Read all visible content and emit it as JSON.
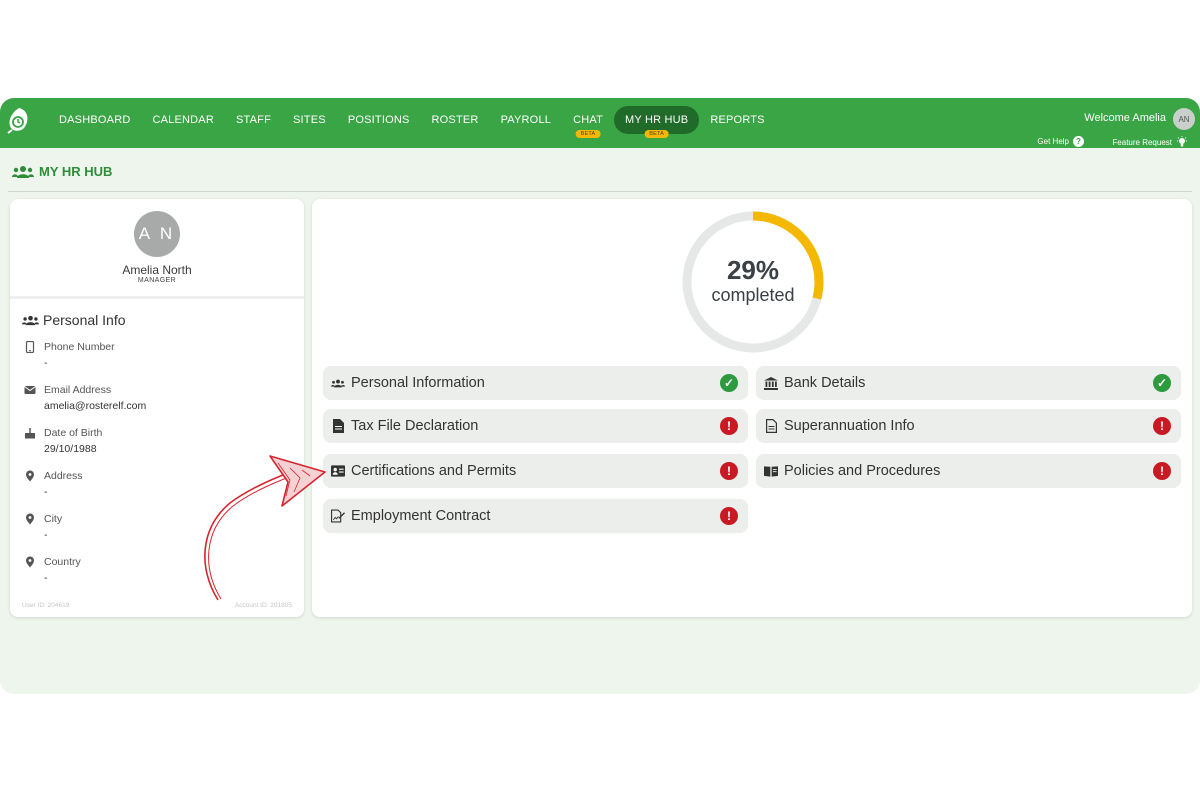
{
  "colors": {
    "brand_green": "#3aa545",
    "active_green": "#216b2a",
    "progress": "#f5b800",
    "ok": "#2e9a3e",
    "warn": "#c81a22",
    "annotation_arrow": "#d6252f"
  },
  "nav": {
    "items": [
      {
        "label": "DASHBOARD"
      },
      {
        "label": "CALENDAR"
      },
      {
        "label": "STAFF"
      },
      {
        "label": "SITES"
      },
      {
        "label": "POSITIONS"
      },
      {
        "label": "ROSTER"
      },
      {
        "label": "PAYROLL"
      },
      {
        "label": "CHAT",
        "badge": "BETA"
      },
      {
        "label": "MY HR HUB",
        "badge": "BETA",
        "active": true
      },
      {
        "label": "REPORTS"
      }
    ],
    "welcome": "Welcome Amelia",
    "avatar_initials": "AN",
    "get_help": "Get Help",
    "feature_request": "Feature Request"
  },
  "page": {
    "title": "MY HR HUB",
    "title_icon": "users-icon"
  },
  "profile": {
    "initials": "A N",
    "name": "Amelia North",
    "role": "MANAGER",
    "section_title": "Personal Info",
    "fields": [
      {
        "icon": "phone-icon",
        "label": "Phone Number",
        "value": "-"
      },
      {
        "icon": "envelope-icon",
        "label": "Email Address",
        "value": "amelia@rosterelf.com"
      },
      {
        "icon": "cake-icon",
        "label": "Date of Birth",
        "value": "29/10/1988"
      },
      {
        "icon": "map-pin-icon",
        "label": "Address",
        "value": "-"
      },
      {
        "icon": "map-pin-icon",
        "label": "City",
        "value": "-"
      },
      {
        "icon": "map-pin-icon",
        "label": "Country",
        "value": "-"
      }
    ],
    "user_id": "User ID: 204619",
    "account_id": "Account ID: 201805"
  },
  "progress": {
    "percent": 29,
    "percent_text": "29%",
    "label": "completed"
  },
  "tasks": [
    {
      "label": "Personal Information",
      "icon": "users-icon",
      "status": "complete"
    },
    {
      "label": "Bank Details",
      "icon": "bank-icon",
      "status": "complete"
    },
    {
      "label": "Tax File Declaration",
      "icon": "document-icon",
      "status": "incomplete"
    },
    {
      "label": "Superannuation Info",
      "icon": "document-outline-icon",
      "status": "incomplete"
    },
    {
      "label": "Certifications and Permits",
      "icon": "id-card-icon",
      "status": "incomplete"
    },
    {
      "label": "Policies and Procedures",
      "icon": "book-icon",
      "status": "incomplete"
    },
    {
      "label": "Employment Contract",
      "icon": "contract-icon",
      "status": "incomplete"
    }
  ]
}
